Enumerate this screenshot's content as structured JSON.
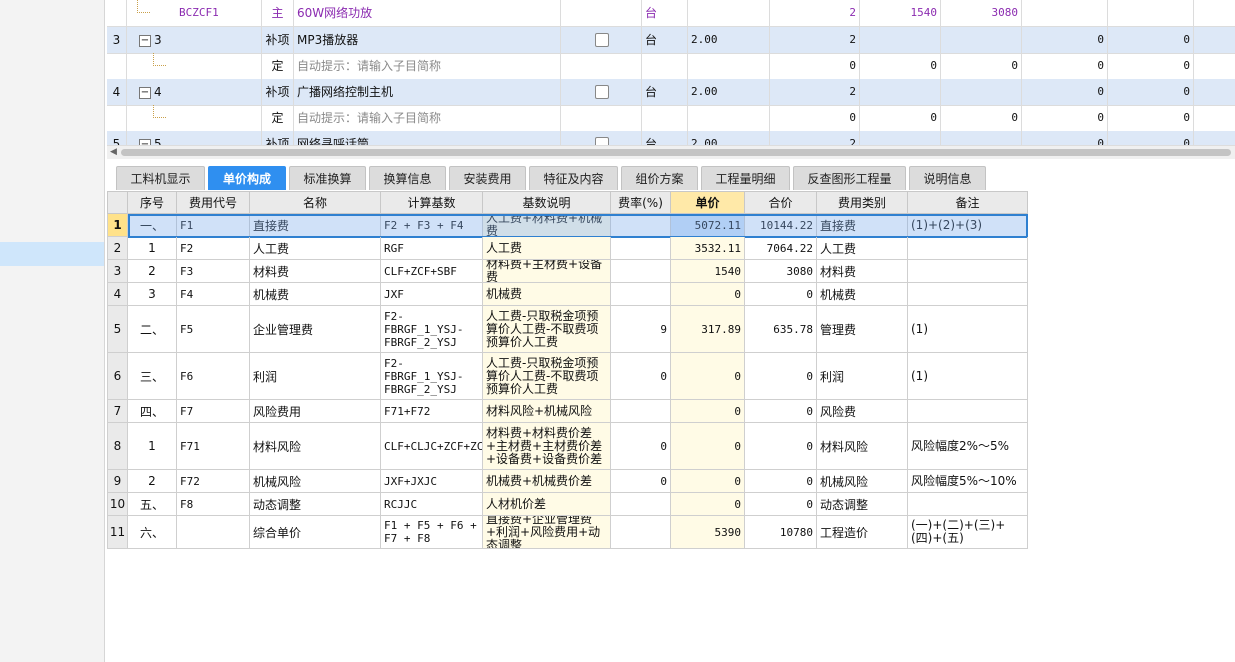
{
  "top_rows": [
    {
      "idx": "",
      "code": "BCZCF1",
      "type": "主",
      "name": "60W网络功放",
      "unit": "台",
      "qty": "",
      "amt": "2",
      "price": "1540",
      "total": "3080",
      "c1": "",
      "c2": ""
    },
    {
      "idx": "3",
      "code": "3",
      "type": "补项",
      "name": "MP3播放器",
      "unit": "台",
      "qty": "2.00",
      "amt": "2",
      "price": "",
      "total": "",
      "c1": "0",
      "c2": "0"
    },
    {
      "idx": "",
      "code": "",
      "type": "定",
      "name": "自动提示：请输入子目简称",
      "unit": "",
      "qty": "",
      "amt": "0",
      "price": "0",
      "total": "0",
      "c1": "0",
      "c2": "0"
    },
    {
      "idx": "4",
      "code": "4",
      "type": "补项",
      "name": "广播网络控制主机",
      "unit": "台",
      "qty": "2.00",
      "amt": "2",
      "price": "",
      "total": "",
      "c1": "0",
      "c2": "0"
    },
    {
      "idx": "",
      "code": "",
      "type": "定",
      "name": "自动提示：请输入子目简称",
      "unit": "",
      "qty": "",
      "amt": "0",
      "price": "0",
      "total": "0",
      "c1": "0",
      "c2": "0"
    },
    {
      "idx": "5",
      "code": "5",
      "type": "补项",
      "name": "网络寻呼话筒",
      "unit": "台",
      "qty": "2.00",
      "amt": "2",
      "price": "",
      "total": "",
      "c1": "0",
      "c2": "0"
    }
  ],
  "tabs": [
    "工料机显示",
    "单价构成",
    "标准换算",
    "换算信息",
    "安装费用",
    "特征及内容",
    "组价方案",
    "工程量明细",
    "反查图形工程量",
    "说明信息"
  ],
  "headers": [
    "序号",
    "费用代号",
    "名称",
    "计算基数",
    "基数说明",
    "费率(%)",
    "单价",
    "合价",
    "费用类别",
    "备注"
  ],
  "rows": [
    {
      "n": "1",
      "seq": "一、",
      "code": "F1",
      "name": "直接费",
      "base": "F2 + F3 + F4",
      "desc": "人工费+材料费+机械费",
      "rate": "",
      "unit": "5072.11",
      "total": "10144.22",
      "cat": "直接费",
      "note": "(1)+(2)+(3)"
    },
    {
      "n": "2",
      "seq": "1",
      "code": "F2",
      "name": "人工费",
      "base": "RGF",
      "desc": "人工费",
      "rate": "",
      "unit": "3532.11",
      "total": "7064.22",
      "cat": "人工费",
      "note": ""
    },
    {
      "n": "3",
      "seq": "2",
      "code": "F3",
      "name": "材料费",
      "base": "CLF+ZCF+SBF",
      "desc": "材料费+主材费+设备费",
      "rate": "",
      "unit": "1540",
      "total": "3080",
      "cat": "材料费",
      "note": ""
    },
    {
      "n": "4",
      "seq": "3",
      "code": "F4",
      "name": "机械费",
      "base": "JXF",
      "desc": "机械费",
      "rate": "",
      "unit": "0",
      "total": "0",
      "cat": "机械费",
      "note": ""
    },
    {
      "n": "5",
      "seq": "二、",
      "code": "F5",
      "name": "企业管理费",
      "base": "F2-FBRGF_1_YSJ-FBRGF_2_YSJ",
      "desc": "人工费-只取税金项预算价人工费-不取费项预算价人工费",
      "rate": "9",
      "unit": "317.89",
      "total": "635.78",
      "cat": "管理费",
      "note": "(1)"
    },
    {
      "n": "6",
      "seq": "三、",
      "code": "F6",
      "name": "利润",
      "base": "F2-FBRGF_1_YSJ-FBRGF_2_YSJ",
      "desc": "人工费-只取税金项预算价人工费-不取费项预算价人工费",
      "rate": "0",
      "unit": "0",
      "total": "0",
      "cat": "利润",
      "note": "(1)"
    },
    {
      "n": "7",
      "seq": "四、",
      "code": "F7",
      "name": "风险费用",
      "base": "F71+F72",
      "desc": "材料风险+机械风险",
      "rate": "",
      "unit": "0",
      "total": "0",
      "cat": "风险费",
      "note": ""
    },
    {
      "n": "8",
      "seq": "1",
      "code": "F71",
      "name": "材料风险",
      "base": "CLF+CLJC+ZCF+ZCJC+SBF+SBJC",
      "desc": "材料费+材料费价差+主材费+主材费价差+设备费+设备费价差",
      "rate": "0",
      "unit": "0",
      "total": "0",
      "cat": "材料风险",
      "note": "风险幅度2%～5%"
    },
    {
      "n": "9",
      "seq": "2",
      "code": "F72",
      "name": "机械风险",
      "base": "JXF+JXJC",
      "desc": "机械费+机械费价差",
      "rate": "0",
      "unit": "0",
      "total": "0",
      "cat": "机械风险",
      "note": "风险幅度5%～10%"
    },
    {
      "n": "10",
      "seq": "五、",
      "code": "F8",
      "name": "动态调整",
      "base": "RCJJC",
      "desc": "人材机价差",
      "rate": "",
      "unit": "0",
      "total": "0",
      "cat": "动态调整",
      "note": ""
    },
    {
      "n": "11",
      "seq": "六、",
      "code": "",
      "name": "综合单价",
      "base": "F1 + F5 + F6 + F7 + F8",
      "desc": "直接费+企业管理费+利润+风险费用+动态调整",
      "rate": "",
      "unit": "5390",
      "total": "10780",
      "cat": "工程造价",
      "note": "(一)+(二)+(三)+(四)+(五)"
    }
  ],
  "colors": {
    "accent": "#2f8ff0",
    "selected_row": "#cfe3fb",
    "price_col": "#fffbe6"
  }
}
